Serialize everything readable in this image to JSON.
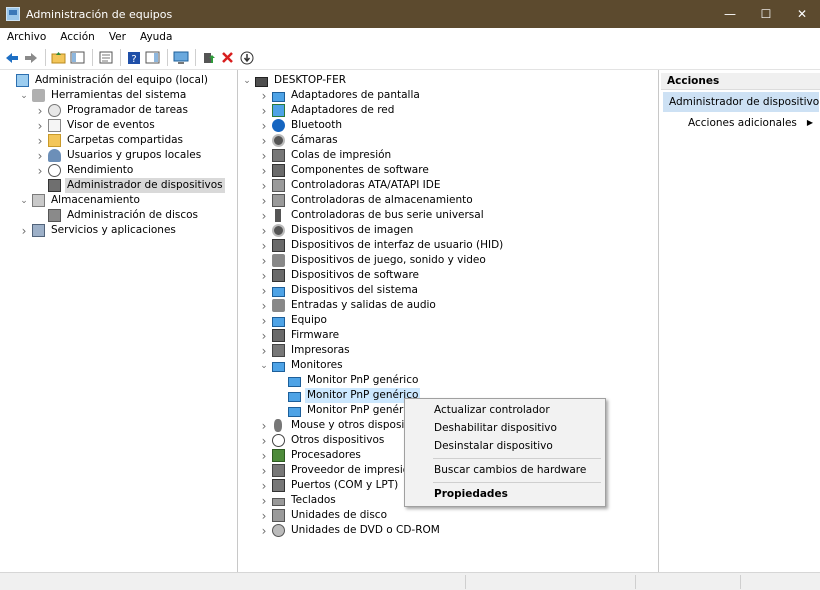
{
  "window": {
    "title": "Administración de equipos",
    "controls": [
      "—",
      "☐",
      "✕"
    ]
  },
  "menu": [
    "Archivo",
    "Acción",
    "Ver",
    "Ayuda"
  ],
  "toolbar_icons": [
    "back-arrow-icon",
    "forward-arrow-icon",
    "up-folder-icon",
    "show-hide-tree-icon",
    "properties-icon",
    "help-icon",
    "action-pane-icon",
    "computer-icon",
    "update-driver-icon",
    "uninstall-icon",
    "scan-hardware-icon"
  ],
  "left_tree": [
    {
      "label": "Administración del equipo (local)",
      "icon": "computer-icon",
      "expander": "",
      "level": 0
    },
    {
      "label": "Herramientas del sistema",
      "icon": "tools-icon",
      "expander": "expanded",
      "level": 1
    },
    {
      "label": "Programador de tareas",
      "icon": "clock-icon",
      "expander": "collapsed",
      "level": 2
    },
    {
      "label": "Visor de eventos",
      "icon": "event-viewer-icon",
      "expander": "collapsed",
      "level": 2
    },
    {
      "label": "Carpetas compartidas",
      "icon": "shared-folder-icon",
      "expander": "collapsed",
      "level": 2
    },
    {
      "label": "Usuarios y grupos locales",
      "icon": "users-icon",
      "expander": "collapsed",
      "level": 2
    },
    {
      "label": "Rendimiento",
      "icon": "performance-icon",
      "expander": "collapsed",
      "level": 2
    },
    {
      "label": "Administrador de dispositivos",
      "icon": "device-manager-icon",
      "expander": "",
      "level": 2,
      "selected": true
    },
    {
      "label": "Almacenamiento",
      "icon": "storage-icon",
      "expander": "expanded",
      "level": 1
    },
    {
      "label": "Administración de discos",
      "icon": "disk-icon",
      "expander": "",
      "level": 2
    },
    {
      "label": "Servicios y aplicaciones",
      "icon": "services-icon",
      "expander": "collapsed",
      "level": 1
    }
  ],
  "device_tree": {
    "root": "DESKTOP-FER",
    "items": [
      {
        "label": "Adaptadores de pantalla",
        "icon": "display-adapter-icon",
        "expander": "collapsed",
        "level": 1
      },
      {
        "label": "Adaptadores de red",
        "icon": "network-adapter-icon",
        "expander": "collapsed",
        "level": 1
      },
      {
        "label": "Bluetooth",
        "icon": "bluetooth-icon",
        "expander": "collapsed",
        "level": 1
      },
      {
        "label": "Cámaras",
        "icon": "camera-icon",
        "expander": "collapsed",
        "level": 1
      },
      {
        "label": "Colas de impresión",
        "icon": "print-queue-icon",
        "expander": "collapsed",
        "level": 1
      },
      {
        "label": "Componentes de software",
        "icon": "software-component-icon",
        "expander": "collapsed",
        "level": 1
      },
      {
        "label": "Controladoras ATA/ATAPI IDE",
        "icon": "ide-controller-icon",
        "expander": "collapsed",
        "level": 1
      },
      {
        "label": "Controladoras de almacenamiento",
        "icon": "storage-controller-icon",
        "expander": "collapsed",
        "level": 1
      },
      {
        "label": "Controladoras de bus serie universal",
        "icon": "usb-icon",
        "expander": "collapsed",
        "level": 1
      },
      {
        "label": "Dispositivos de imagen",
        "icon": "imaging-device-icon",
        "expander": "collapsed",
        "level": 1
      },
      {
        "label": "Dispositivos de interfaz de usuario (HID)",
        "icon": "hid-icon",
        "expander": "collapsed",
        "level": 1
      },
      {
        "label": "Dispositivos de juego, sonido y video",
        "icon": "audio-icon",
        "expander": "collapsed",
        "level": 1
      },
      {
        "label": "Dispositivos de software",
        "icon": "software-device-icon",
        "expander": "collapsed",
        "level": 1
      },
      {
        "label": "Dispositivos del sistema",
        "icon": "system-device-icon",
        "expander": "collapsed",
        "level": 1
      },
      {
        "label": "Entradas y salidas de audio",
        "icon": "audio-io-icon",
        "expander": "collapsed",
        "level": 1
      },
      {
        "label": "Equipo",
        "icon": "monitor-icon",
        "expander": "collapsed",
        "level": 1
      },
      {
        "label": "Firmware",
        "icon": "firmware-icon",
        "expander": "collapsed",
        "level": 1
      },
      {
        "label": "Impresoras",
        "icon": "printer-icon",
        "expander": "collapsed",
        "level": 1
      },
      {
        "label": "Monitores",
        "icon": "monitor-icon",
        "expander": "expanded",
        "level": 1
      },
      {
        "label": "Monitor PnP genérico",
        "icon": "monitor-icon",
        "expander": "",
        "level": 2
      },
      {
        "label": "Monitor PnP genérico",
        "icon": "monitor-icon",
        "expander": "",
        "level": 2,
        "selected": true
      },
      {
        "label": "Monitor PnP genérico",
        "icon": "monitor-icon",
        "expander": "",
        "level": 2
      },
      {
        "label": "Mouse y otros dispositivos",
        "icon": "mouse-icon",
        "expander": "collapsed",
        "level": 1
      },
      {
        "label": "Otros dispositivos",
        "icon": "unknown-device-icon",
        "expander": "collapsed",
        "level": 1
      },
      {
        "label": "Procesadores",
        "icon": "processor-icon",
        "expander": "collapsed",
        "level": 1
      },
      {
        "label": "Proveedor de impresión WSD",
        "icon": "print-provider-icon",
        "expander": "collapsed",
        "level": 1
      },
      {
        "label": "Puertos (COM y LPT)",
        "icon": "port-icon",
        "expander": "collapsed",
        "level": 1
      },
      {
        "label": "Teclados",
        "icon": "keyboard-icon",
        "expander": "collapsed",
        "level": 1
      },
      {
        "label": "Unidades de disco",
        "icon": "disk-drive-icon",
        "expander": "collapsed",
        "level": 1
      },
      {
        "label": "Unidades de DVD o CD-ROM",
        "icon": "dvd-icon",
        "expander": "collapsed",
        "level": 1
      }
    ]
  },
  "actions": {
    "header": "Acciones",
    "section": "Administrador de dispositivos",
    "more": "Acciones adicionales"
  },
  "context_menu": {
    "items": [
      "Actualizar controlador",
      "Deshabilitar dispositivo",
      "Desinstalar dispositivo",
      "Buscar cambios de hardware",
      "Propiedades"
    ]
  }
}
